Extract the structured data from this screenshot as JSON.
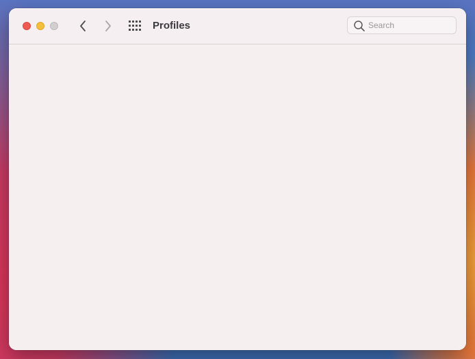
{
  "window": {
    "title": "Profiles"
  },
  "toolbar": {
    "traffic_lights": {
      "close_color": "#ee5a52",
      "minimize_color": "#f5be3b",
      "zoom_color": "#d3cfd0"
    },
    "back_icon": "chevron-left-icon",
    "forward_icon": "chevron-right-icon",
    "show_all_icon": "grid-icon"
  },
  "search": {
    "placeholder": "Search",
    "value": "",
    "icon": "search-icon"
  },
  "content": {}
}
